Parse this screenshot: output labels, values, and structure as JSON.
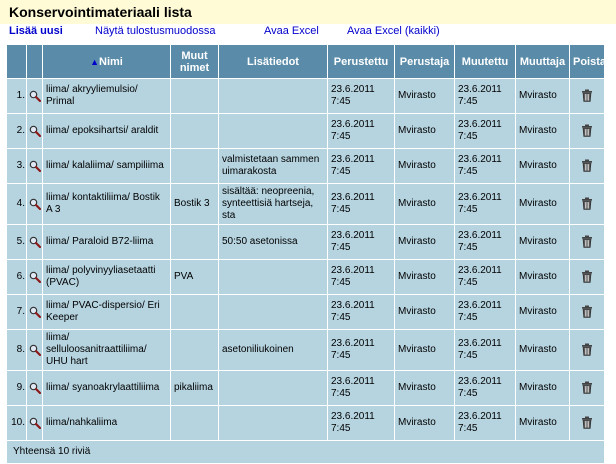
{
  "page": {
    "title": "Konservointimateriaali lista",
    "actions": {
      "add": "Lisää uusi",
      "print": "Näytä tulostusmuodossa",
      "excel": "Avaa Excel",
      "excel_all": "Avaa Excel (kaikki)"
    }
  },
  "table": {
    "headers": {
      "name": "Nimi",
      "other_names": "Muut nimet",
      "info": "Lisätiedot",
      "created": "Perustettu",
      "creator": "Perustaja",
      "modified": "Muutettu",
      "modifier": "Muuttaja",
      "delete": "Poista"
    },
    "sort_arrow": "▲",
    "rows": [
      {
        "num": "1.",
        "name": "liima/ akryyliemulsio/ Primal",
        "other": "",
        "info": "",
        "created": "23.6.2011 7:45",
        "creator": "Mvirasto",
        "modified": "23.6.2011 7:45",
        "modifier": "Mvirasto"
      },
      {
        "num": "2.",
        "name": "liima/ epoksihartsi/ araldit",
        "other": "",
        "info": "",
        "created": "23.6.2011 7:45",
        "creator": "Mvirasto",
        "modified": "23.6.2011 7:45",
        "modifier": "Mvirasto"
      },
      {
        "num": "3.",
        "name": "liima/ kalaliima/ sampiliima",
        "other": "",
        "info": "valmistetaan sammen uimarakosta",
        "created": "23.6.2011 7:45",
        "creator": "Mvirasto",
        "modified": "23.6.2011 7:45",
        "modifier": "Mvirasto"
      },
      {
        "num": "4.",
        "name": "liima/ kontaktiliima/ Bostik A 3",
        "other": "Bostik 3",
        "info": "sisältää: neopreenia, synteettisiä hartseja, sta",
        "created": "23.6.2011 7:45",
        "creator": "Mvirasto",
        "modified": "23.6.2011 7:45",
        "modifier": "Mvirasto"
      },
      {
        "num": "5.",
        "name": "liima/ Paraloid B72-liima",
        "other": "",
        "info": "50:50 asetonissa",
        "created": "23.6.2011 7:45",
        "creator": "Mvirasto",
        "modified": "23.6.2011 7:45",
        "modifier": "Mvirasto"
      },
      {
        "num": "6.",
        "name": "liima/ polyvinyyliasetaatti (PVAC)",
        "other": "PVA",
        "info": "",
        "created": "23.6.2011 7:45",
        "creator": "Mvirasto",
        "modified": "23.6.2011 7:45",
        "modifier": "Mvirasto"
      },
      {
        "num": "7.",
        "name": "liima/ PVAC-dispersio/ Eri Keeper",
        "other": "",
        "info": "",
        "created": "23.6.2011 7:45",
        "creator": "Mvirasto",
        "modified": "23.6.2011 7:45",
        "modifier": "Mvirasto"
      },
      {
        "num": "8.",
        "name": "liima/ selluloosanitraattiliima/ UHU hart",
        "other": "",
        "info": "asetoniliukoinen",
        "created": "23.6.2011 7:45",
        "creator": "Mvirasto",
        "modified": "23.6.2011 7:45",
        "modifier": "Mvirasto"
      },
      {
        "num": "9.",
        "name": "liima/ syanoakrylaattiliima",
        "other": "pikaliima",
        "info": "",
        "created": "23.6.2011 7:45",
        "creator": "Mvirasto",
        "modified": "23.6.2011 7:45",
        "modifier": "Mvirasto"
      },
      {
        "num": "10.",
        "name": "liima/nahkaliima",
        "other": "",
        "info": "",
        "created": "23.6.2011 7:45",
        "creator": "Mvirasto",
        "modified": "23.6.2011 7:45",
        "modifier": "Mvirasto"
      }
    ],
    "footer": "Yhteensä 10 riviä"
  },
  "colors": {
    "header_bg": "#5a8caa",
    "row_bg": "#b6d4e0",
    "title_bg": "#fffbd6",
    "link": "#0000cc"
  },
  "icons": {
    "view": "magnifier-icon",
    "delete": "trash-icon"
  }
}
